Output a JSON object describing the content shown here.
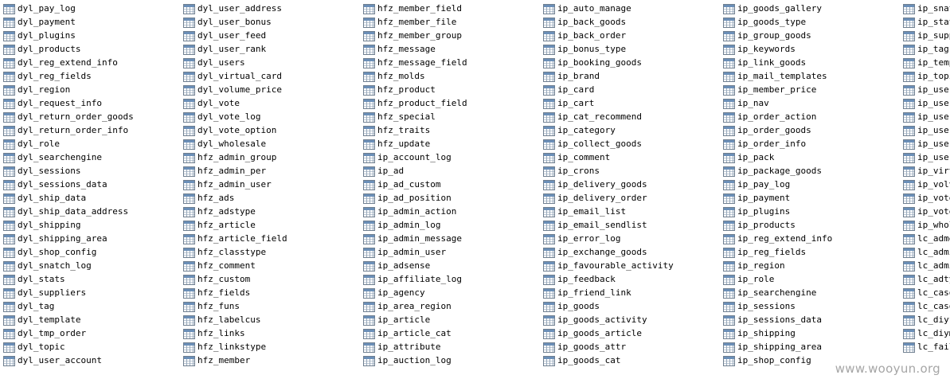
{
  "columns": [
    {
      "items": [
        "dyl_pay_log",
        "dyl_payment",
        "dyl_plugins",
        "dyl_products",
        "dyl_reg_extend_info",
        "dyl_reg_fields",
        "dyl_region",
        "dyl_request_info",
        "dyl_return_order_goods",
        "dyl_return_order_info",
        "dyl_role",
        "dyl_searchengine",
        "dyl_sessions",
        "dyl_sessions_data",
        "dyl_ship_data",
        "dyl_ship_data_address",
        "dyl_shipping",
        "dyl_shipping_area",
        "dyl_shop_config",
        "dyl_snatch_log",
        "dyl_stats",
        "dyl_suppliers",
        "dyl_tag",
        "dyl_template",
        "dyl_tmp_order",
        "dyl_topic",
        "dyl_user_account"
      ]
    },
    {
      "items": [
        "dyl_user_address",
        "dyl_user_bonus",
        "dyl_user_feed",
        "dyl_user_rank",
        "dyl_users",
        "dyl_virtual_card",
        "dyl_volume_price",
        "dyl_vote",
        "dyl_vote_log",
        "dyl_vote_option",
        "dyl_wholesale",
        "hfz_admin_group",
        "hfz_admin_per",
        "hfz_admin_user",
        "hfz_ads",
        "hfz_adstype",
        "hfz_article",
        "hfz_article_field",
        "hfz_classtype",
        "hfz_comment",
        "hfz_custom",
        "hfz_fields",
        "hfz_funs",
        "hfz_labelcus",
        "hfz_links",
        "hfz_linkstype",
        "hfz_member"
      ]
    },
    {
      "items": [
        "hfz_member_field",
        "hfz_member_file",
        "hfz_member_group",
        "hfz_message",
        "hfz_message_field",
        "hfz_molds",
        "hfz_product",
        "hfz_product_field",
        "hfz_special",
        "hfz_traits",
        "hfz_update",
        "ip_account_log",
        "ip_ad",
        "ip_ad_custom",
        "ip_ad_position",
        "ip_admin_action",
        "ip_admin_log",
        "ip_admin_message",
        "ip_admin_user",
        "ip_adsense",
        "ip_affiliate_log",
        "ip_agency",
        "ip_area_region",
        "ip_article",
        "ip_article_cat",
        "ip_attribute",
        "ip_auction_log"
      ]
    },
    {
      "items": [
        "ip_auto_manage",
        "ip_back_goods",
        "ip_back_order",
        "ip_bonus_type",
        "ip_booking_goods",
        "ip_brand",
        "ip_card",
        "ip_cart",
        "ip_cat_recommend",
        "ip_category",
        "ip_collect_goods",
        "ip_comment",
        "ip_crons",
        "ip_delivery_goods",
        "ip_delivery_order",
        "ip_email_list",
        "ip_email_sendlist",
        "ip_error_log",
        "ip_exchange_goods",
        "ip_favourable_activity",
        "ip_feedback",
        "ip_friend_link",
        "ip_goods",
        "ip_goods_activity",
        "ip_goods_article",
        "ip_goods_attr",
        "ip_goods_cat"
      ]
    },
    {
      "items": [
        "ip_goods_gallery",
        "ip_goods_type",
        "ip_group_goods",
        "ip_keywords",
        "ip_link_goods",
        "ip_mail_templates",
        "ip_member_price",
        "ip_nav",
        "ip_order_action",
        "ip_order_goods",
        "ip_order_info",
        "ip_pack",
        "ip_package_goods",
        "ip_pay_log",
        "ip_payment",
        "ip_plugins",
        "ip_products",
        "ip_reg_extend_info",
        "ip_reg_fields",
        "ip_region",
        "ip_role",
        "ip_searchengine",
        "ip_sessions",
        "ip_sessions_data",
        "ip_shipping",
        "ip_shipping_area",
        "ip_shop_config"
      ]
    },
    {
      "items": [
        "ip_snat",
        "ip_stat",
        "ip_supp",
        "ip_tag",
        "ip_temp",
        "ip_topi",
        "ip_user",
        "ip_user",
        "ip_user",
        "ip_user",
        "ip_user",
        "ip_user",
        "ip_virt",
        "ip_volv",
        "ip_vote",
        "ip_vote",
        "ip_whol",
        "lc_adme",
        "lc_admi",
        "lc_admi",
        "lc_adty",
        "lc_caso",
        "lc_caso",
        "lc_diyf",
        "lc_diym",
        "lc_fail"
      ]
    }
  ],
  "watermark": "www.wooyun.org"
}
